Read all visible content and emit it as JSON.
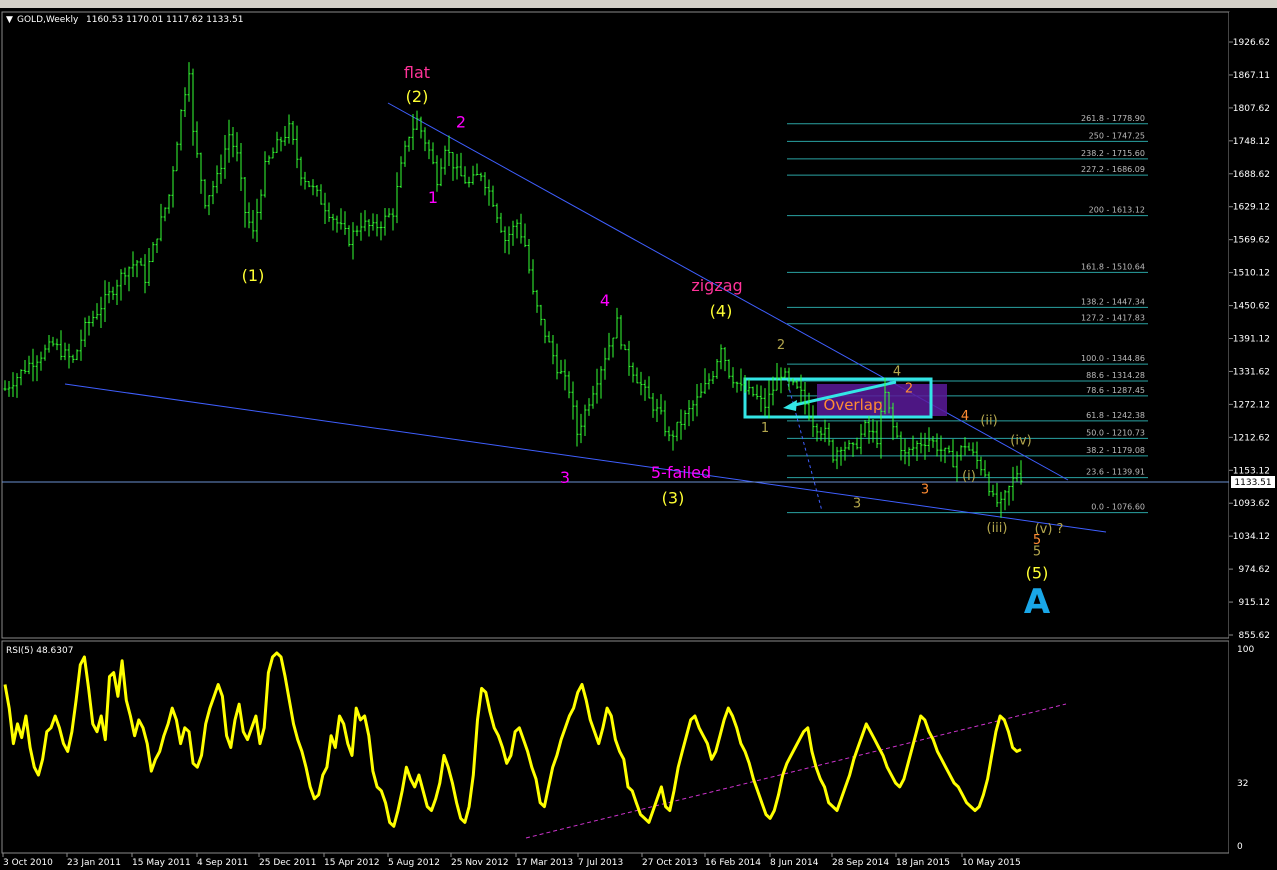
{
  "window": {
    "symbol_label": "GOLD,Weekly",
    "ohlc_label": "1160.53 1170.01 1117.62 1133.51",
    "current_price_label": "1133.51"
  },
  "colors": {
    "background": "#000000",
    "candles": "#33ff33",
    "price_line": "#6a8fcf",
    "trendline": "#3f5fff",
    "fib": "#2aa3a3",
    "fib_text": "#bbbbbb",
    "rsi": "#ffff00",
    "rsi_trend": "#cc33cc",
    "yellow": "#ffff33",
    "magenta": "#ff00ff",
    "pink": "#ff3399",
    "olive": "#b3a64d",
    "orange": "#ff8c33",
    "cyan": "#33e6e6",
    "blue_letter": "#19a7e8"
  },
  "chart_data": [
    {
      "type": "candlestick",
      "title": "GOLD,Weekly",
      "time_range": [
        "3 Oct 2010",
        "10 Aug 2015"
      ],
      "x_ticks": [
        "3 Oct 2010",
        "23 Jan 2011",
        "15 May 2011",
        "4 Sep 2011",
        "25 Dec 2011",
        "15 Apr 2012",
        "5 Aug 2012",
        "25 Nov 2012",
        "17 Mar 2013",
        "7 Jul 2013",
        "27 Oct 2013",
        "16 Feb 2014",
        "8 Jun 2014",
        "28 Sep 2014",
        "18 Jan 2015",
        "10 May 2015"
      ],
      "y_ticks": [
        "1926.62",
        "1867.11",
        "1807.62",
        "1748.12",
        "1688.62",
        "1629.12",
        "1569.62",
        "1510.12",
        "1450.62",
        "1391.12",
        "1331.62",
        "1272.12",
        "1212.62",
        "1153.12",
        "1093.62",
        "1034.12",
        "974.62",
        "915.12",
        "855.62"
      ],
      "ylim": [
        855.62,
        1926.62
      ],
      "last_close": 1133.51,
      "price_path": [
        {
          "week": 0,
          "close": 1300
        },
        {
          "week": 6,
          "close": 1345
        },
        {
          "week": 12,
          "close": 1380
        },
        {
          "week": 17,
          "close": 1350
        },
        {
          "week": 20,
          "close": 1410
        },
        {
          "week": 26,
          "close": 1470
        },
        {
          "week": 30,
          "close": 1515
        },
        {
          "week": 33,
          "close": 1530
        },
        {
          "week": 35,
          "close": 1500
        },
        {
          "week": 38,
          "close": 1580
        },
        {
          "week": 41,
          "close": 1650
        },
        {
          "week": 44,
          "close": 1800
        },
        {
          "week": 46,
          "close": 1880
        },
        {
          "week": 47,
          "close": 1760
        },
        {
          "week": 50,
          "close": 1640
        },
        {
          "week": 53,
          "close": 1680
        },
        {
          "week": 56,
          "close": 1760
        },
        {
          "week": 58,
          "close": 1720
        },
        {
          "week": 60,
          "close": 1620
        },
        {
          "week": 62,
          "close": 1580
        },
        {
          "week": 65,
          "close": 1700
        },
        {
          "week": 68,
          "close": 1740
        },
        {
          "week": 71,
          "close": 1770
        },
        {
          "week": 74,
          "close": 1690
        },
        {
          "week": 77,
          "close": 1660
        },
        {
          "week": 80,
          "close": 1630
        },
        {
          "week": 83,
          "close": 1600
        },
        {
          "week": 86,
          "close": 1570
        },
        {
          "week": 89,
          "close": 1600
        },
        {
          "week": 92,
          "close": 1590
        },
        {
          "week": 94,
          "close": 1600
        },
        {
          "week": 97,
          "close": 1620
        },
        {
          "week": 99,
          "close": 1700
        },
        {
          "week": 101,
          "close": 1760
        },
        {
          "week": 103,
          "close": 1785
        },
        {
          "week": 106,
          "close": 1730
        },
        {
          "week": 108,
          "close": 1680
        },
        {
          "week": 110,
          "close": 1740
        },
        {
          "week": 113,
          "close": 1690
        },
        {
          "week": 116,
          "close": 1670
        },
        {
          "week": 119,
          "close": 1690
        },
        {
          "week": 122,
          "close": 1640
        },
        {
          "week": 125,
          "close": 1570
        },
        {
          "week": 128,
          "close": 1600
        },
        {
          "week": 130,
          "close": 1560
        },
        {
          "week": 132,
          "close": 1470
        },
        {
          "week": 134,
          "close": 1420
        },
        {
          "week": 136,
          "close": 1380
        },
        {
          "week": 138,
          "close": 1340
        },
        {
          "week": 141,
          "close": 1300
        },
        {
          "week": 143,
          "close": 1220
        },
        {
          "week": 145,
          "close": 1260
        },
        {
          "week": 147,
          "close": 1300
        },
        {
          "week": 149,
          "close": 1340
        },
        {
          "week": 151,
          "close": 1380
        },
        {
          "week": 153,
          "close": 1420
        },
        {
          "week": 155,
          "close": 1360
        },
        {
          "week": 158,
          "close": 1320
        },
        {
          "week": 161,
          "close": 1280
        },
        {
          "week": 164,
          "close": 1250
        },
        {
          "week": 166,
          "close": 1210
        },
        {
          "week": 168,
          "close": 1230
        },
        {
          "week": 171,
          "close": 1260
        },
        {
          "week": 174,
          "close": 1290
        },
        {
          "week": 177,
          "close": 1330
        },
        {
          "week": 179,
          "close": 1380
        },
        {
          "week": 181,
          "close": 1330
        },
        {
          "week": 184,
          "close": 1300
        },
        {
          "week": 187,
          "close": 1290
        },
        {
          "week": 190,
          "close": 1270
        },
        {
          "week": 192,
          "close": 1300
        },
        {
          "week": 194,
          "close": 1330
        },
        {
          "week": 196,
          "close": 1310
        },
        {
          "week": 199,
          "close": 1290
        },
        {
          "week": 202,
          "close": 1240
        },
        {
          "week": 205,
          "close": 1220
        },
        {
          "week": 207,
          "close": 1180
        },
        {
          "week": 209,
          "close": 1200
        },
        {
          "week": 212,
          "close": 1190
        },
        {
          "week": 215,
          "close": 1230
        },
        {
          "week": 218,
          "close": 1210
        },
        {
          "week": 220,
          "close": 1290
        },
        {
          "week": 222,
          "close": 1230
        },
        {
          "week": 225,
          "close": 1180
        },
        {
          "week": 228,
          "close": 1200
        },
        {
          "week": 231,
          "close": 1210
        },
        {
          "week": 234,
          "close": 1190
        },
        {
          "week": 237,
          "close": 1170
        },
        {
          "week": 240,
          "close": 1200
        },
        {
          "week": 242,
          "close": 1180
        },
        {
          "week": 245,
          "close": 1150
        },
        {
          "week": 247,
          "close": 1100
        },
        {
          "week": 249,
          "close": 1090
        },
        {
          "week": 251,
          "close": 1120
        },
        {
          "week": 253,
          "close": 1150
        },
        {
          "week": 254,
          "close": 1133.51
        }
      ],
      "fibonacci_levels": [
        {
          "label": "261.8 - 1778.90",
          "price": 1778.9
        },
        {
          "label": "250 - 1747.25",
          "price": 1747.25
        },
        {
          "label": "238.2 - 1715.60",
          "price": 1715.6
        },
        {
          "label": "227.2 - 1686.09",
          "price": 1686.09
        },
        {
          "label": "200 - 1613.12",
          "price": 1613.12
        },
        {
          "label": "161.8 - 1510.64",
          "price": 1510.64
        },
        {
          "label": "138.2 - 1447.34",
          "price": 1447.34
        },
        {
          "label": "127.2 - 1417.83",
          "price": 1417.83
        },
        {
          "label": "100.0 - 1344.86",
          "price": 1344.86
        },
        {
          "label": "88.6 - 1314.28",
          "price": 1314.28
        },
        {
          "label": "78.6 - 1287.45",
          "price": 1287.45
        },
        {
          "label": "61.8 - 1242.38",
          "price": 1242.38
        },
        {
          "label": "50.0 - 1210.73",
          "price": 1210.73
        },
        {
          "label": "38.2 - 1179.08",
          "price": 1179.08
        },
        {
          "label": "23.6 - 1139.91",
          "price": 1139.91
        },
        {
          "label": "0.0 - 1076.60",
          "price": 1076.6
        }
      ],
      "annotations": [
        {
          "text": "(1)",
          "week": 62,
          "price": 1495,
          "color": "yellow"
        },
        {
          "text": "flat",
          "week": 103,
          "price": 1862,
          "color": "pink"
        },
        {
          "text": "(2)",
          "week": 103,
          "price": 1818,
          "color": "yellow"
        },
        {
          "text": "2",
          "week": 114,
          "price": 1772,
          "color": "magenta"
        },
        {
          "text": "1",
          "week": 107,
          "price": 1636,
          "color": "magenta"
        },
        {
          "text": "4",
          "week": 150,
          "price": 1450,
          "color": "magenta"
        },
        {
          "text": "3",
          "week": 140,
          "price": 1130,
          "color": "magenta"
        },
        {
          "text": "zigzag",
          "week": 178,
          "price": 1477,
          "color": "pink"
        },
        {
          "text": "(4)",
          "week": 179,
          "price": 1431,
          "color": "yellow"
        },
        {
          "text": "5-failed",
          "week": 169,
          "price": 1139,
          "color": "magenta"
        },
        {
          "text": "(3)",
          "week": 167,
          "price": 1093,
          "color": "yellow"
        },
        {
          "text": "2",
          "week": 194,
          "price": 1372,
          "color": "olive"
        },
        {
          "text": "1",
          "week": 190,
          "price": 1222,
          "color": "olive"
        },
        {
          "text": "4",
          "week": 223,
          "price": 1324,
          "color": "olive"
        },
        {
          "text": "2",
          "week": 226,
          "price": 1294,
          "color": "orange"
        },
        {
          "text": "4",
          "week": 240,
          "price": 1244,
          "color": "orange"
        },
        {
          "text": "3",
          "week": 230,
          "price": 1111,
          "color": "orange"
        },
        {
          "text": "3",
          "week": 213,
          "price": 1086,
          "color": "olive"
        },
        {
          "text": "(ii)",
          "week": 246,
          "price": 1236,
          "color": "olive"
        },
        {
          "text": "(i)",
          "week": 241,
          "price": 1136,
          "color": "olive"
        },
        {
          "text": "(iv)",
          "week": 254,
          "price": 1200,
          "color": "olive"
        },
        {
          "text": "(iii)",
          "week": 248,
          "price": 1042,
          "color": "olive"
        },
        {
          "text": "(v) ?",
          "week": 261,
          "price": 1040,
          "color": "olive"
        },
        {
          "text": "5",
          "week": 258,
          "price": 1020,
          "color": "orange"
        },
        {
          "text": "5",
          "week": 258,
          "price": 999,
          "color": "olive"
        },
        {
          "text": "(5)",
          "week": 258,
          "price": 958,
          "color": "yellow"
        },
        {
          "text": "Overlap",
          "week": 212,
          "price": 1262,
          "color": "orange"
        },
        {
          "text": "A",
          "week": 258,
          "price": 895,
          "color": "blue_letter"
        }
      ]
    },
    {
      "type": "line",
      "title": "RSI(5) 48.6307",
      "ylim": [
        0,
        100
      ],
      "y_ticks": [
        "100",
        "32",
        "0"
      ],
      "last_value": 48.6307,
      "values": [
        82,
        70,
        52,
        62,
        55,
        66,
        50,
        40,
        36,
        44,
        58,
        60,
        66,
        60,
        52,
        48,
        58,
        74,
        92,
        96,
        80,
        62,
        58,
        66,
        54,
        86,
        88,
        76,
        94,
        74,
        66,
        56,
        64,
        60,
        52,
        38,
        44,
        48,
        56,
        62,
        70,
        64,
        52,
        60,
        58,
        42,
        40,
        46,
        62,
        70,
        76,
        82,
        76,
        56,
        50,
        64,
        72,
        58,
        54,
        60,
        66,
        52,
        60,
        88,
        96,
        98,
        96,
        86,
        74,
        62,
        54,
        48,
        40,
        30,
        24,
        26,
        36,
        40,
        56,
        50,
        66,
        62,
        52,
        46,
        70,
        64,
        66,
        56,
        38,
        30,
        28,
        22,
        12,
        10,
        18,
        28,
        40,
        34,
        30,
        36,
        28,
        20,
        18,
        24,
        32,
        46,
        40,
        32,
        22,
        14,
        12,
        20,
        36,
        64,
        80,
        78,
        68,
        60,
        56,
        50,
        42,
        46,
        58,
        60,
        54,
        48,
        40,
        34,
        22,
        20,
        30,
        40,
        46,
        54,
        60,
        66,
        70,
        78,
        82,
        74,
        64,
        58,
        52,
        60,
        70,
        66,
        54,
        48,
        44,
        30,
        28,
        22,
        16,
        14,
        12,
        18,
        24,
        30,
        20,
        18,
        28,
        40,
        48,
        56,
        64,
        66,
        60,
        56,
        52,
        44,
        48,
        56,
        64,
        70,
        66,
        60,
        52,
        48,
        42,
        34,
        28,
        22,
        16,
        14,
        18,
        26,
        36,
        42,
        46,
        50,
        54,
        58,
        60,
        48,
        40,
        34,
        30,
        22,
        20,
        18,
        24,
        30,
        36,
        44,
        50,
        56,
        62,
        58,
        54,
        50,
        46,
        40,
        36,
        32,
        30,
        34,
        42,
        50,
        58,
        66,
        64,
        58,
        54,
        48,
        44,
        40,
        36,
        32,
        30,
        26,
        22,
        20,
        18,
        20,
        26,
        34,
        46,
        58,
        66,
        64,
        58,
        50,
        48,
        49
      ]
    }
  ],
  "rsi_window": {
    "label": "RSI(5) 48.6307"
  }
}
